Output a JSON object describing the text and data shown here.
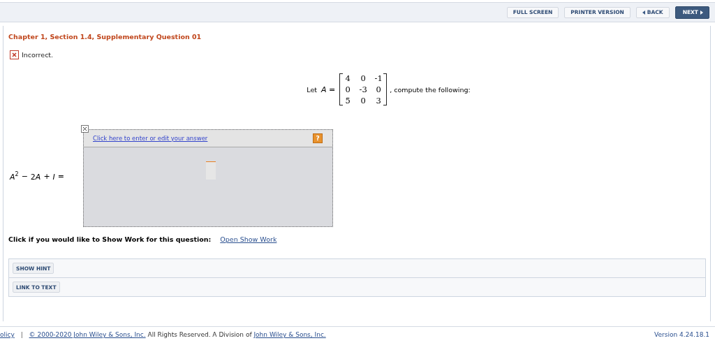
{
  "toolbar": {
    "buttons": [
      {
        "label": "FULL SCREEN",
        "kind": "plain"
      },
      {
        "label": "PRINTER VERSION",
        "kind": "plain"
      },
      {
        "label": "BACK",
        "kind": "back"
      },
      {
        "label": "NEXT",
        "kind": "next"
      }
    ]
  },
  "question": {
    "title": "Chapter 1, Section 1.4, Supplementary Question 01",
    "result": {
      "correct": false,
      "text": "Incorrect."
    },
    "prompt": {
      "before": "Let",
      "variable": "*A* =",
      "matrix": [
        [
          "4",
          "0",
          "-1"
        ],
        [
          "0",
          "-3",
          "0"
        ],
        [
          "5",
          "0",
          "3"
        ]
      ],
      "after": ", compute the following:"
    },
    "expression": [
      {
        "text": "A",
        "kind": "var",
        "sup": "2"
      },
      {
        "text": "−",
        "kind": "op"
      },
      {
        "text": "2",
        "kind": "num"
      },
      {
        "text": "A",
        "kind": "var"
      },
      {
        "text": "+",
        "kind": "op"
      },
      {
        "text": "I",
        "kind": "var"
      },
      {
        "text": "=",
        "kind": "op"
      }
    ],
    "answer_box": {
      "link": "Click here to enter or edit your answer",
      "help": "?"
    },
    "show_work": {
      "label": "Click if you would like to Show Work for this question:",
      "link": "Open Show Work"
    },
    "actions": [
      "SHOW HINT",
      "LINK TO TEXT"
    ]
  },
  "footer": {
    "parts": [
      {
        "text": "olicy",
        "kind": "link"
      },
      {
        "text": "|",
        "kind": "separator"
      },
      {
        "text": "© 2000-2020 John Wiley & Sons, Inc.",
        "kind": "link"
      },
      {
        "text": "All Rights Reserved. A Division of",
        "kind": "text"
      },
      {
        "text": "John Wiley & Sons, Inc.",
        "kind": "link"
      }
    ],
    "version": "Version 4.24.18.1"
  }
}
